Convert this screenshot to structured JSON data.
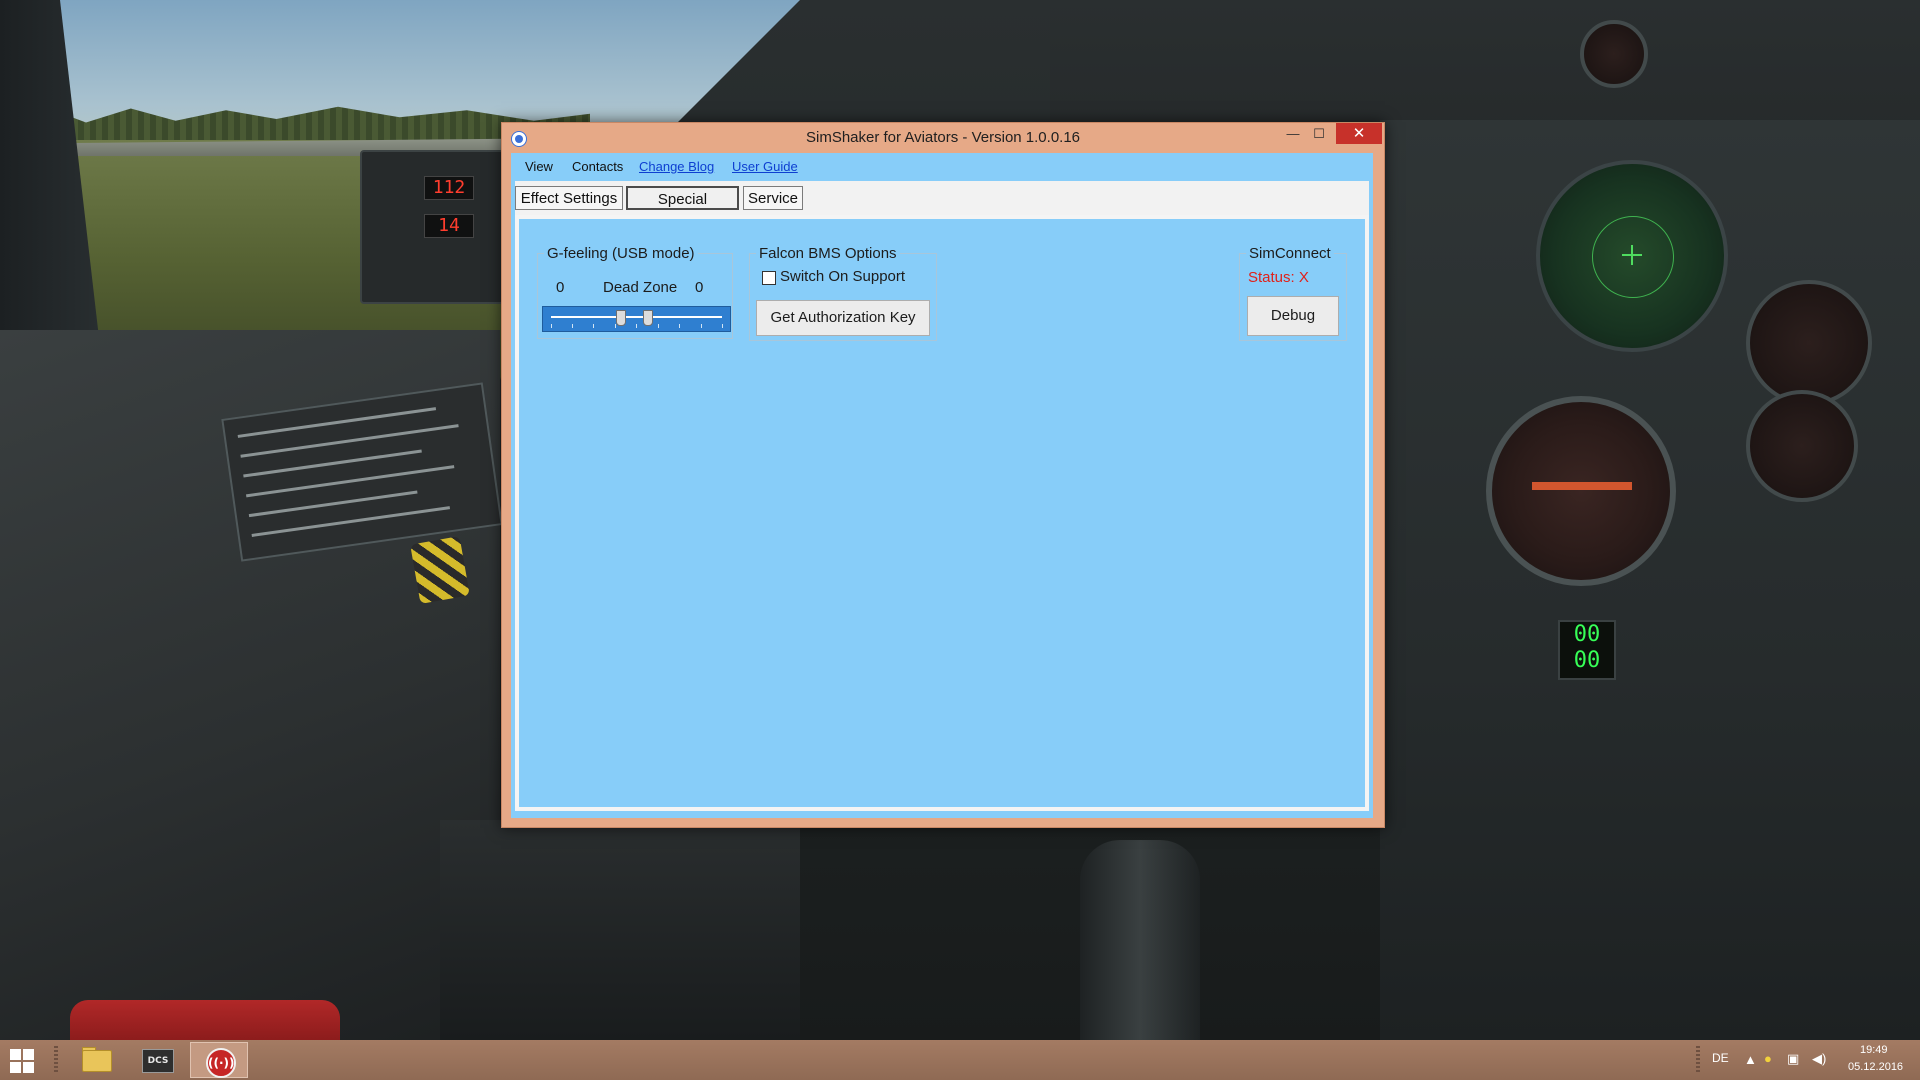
{
  "desktop": {
    "cockpit_readouts": {
      "upper_digits": "112",
      "lower_digits": "14",
      "green_display_top": "00",
      "green_display_bottom": "00"
    }
  },
  "window": {
    "title": "SimShaker for Aviators  - Version 1.0.0.16",
    "minimize_glyph": "—",
    "maximize_glyph": "☐",
    "close_glyph": "✕",
    "menu": {
      "view": "View",
      "contacts": "Contacts",
      "change_blog": "Change Blog",
      "user_guide": "User Guide"
    },
    "tabs": [
      {
        "label": "Effect Settings",
        "selected": false
      },
      {
        "label": "Special Options",
        "selected": true
      },
      {
        "label": "Service",
        "selected": false
      }
    ],
    "g_feeling": {
      "title": "G-feeling (USB mode)",
      "left_value": "0",
      "dead_zone_label": "Dead Zone",
      "right_value": "0",
      "slider_low_fraction": 0.41,
      "slider_high_fraction": 0.56
    },
    "falcon": {
      "title": "Falcon BMS Options",
      "switch_label": "Switch On Support",
      "switch_checked": false,
      "auth_button": "Get Authorization Key"
    },
    "simconnect": {
      "title": "SimConnect",
      "status_label": "Status: X",
      "debug_button": "Debug"
    }
  },
  "taskbar": {
    "apps": [
      {
        "name": "File Explorer",
        "icon": "folder-icon",
        "active": false
      },
      {
        "name": "DCS",
        "icon": "dcs-icon",
        "label": "DCS",
        "active": false
      },
      {
        "name": "SimShaker for Aviators",
        "icon": "simshaker-icon",
        "active": true
      }
    ],
    "language": "DE",
    "time": "19:49",
    "date": "05.12.2016"
  },
  "colors": {
    "window_frame": "#e6a987",
    "client_bg": "#87cdf9",
    "close_button": "#c7312a",
    "link": "#0e3fd1",
    "status_red": "#e0211a",
    "taskbar": "#9c735c"
  }
}
